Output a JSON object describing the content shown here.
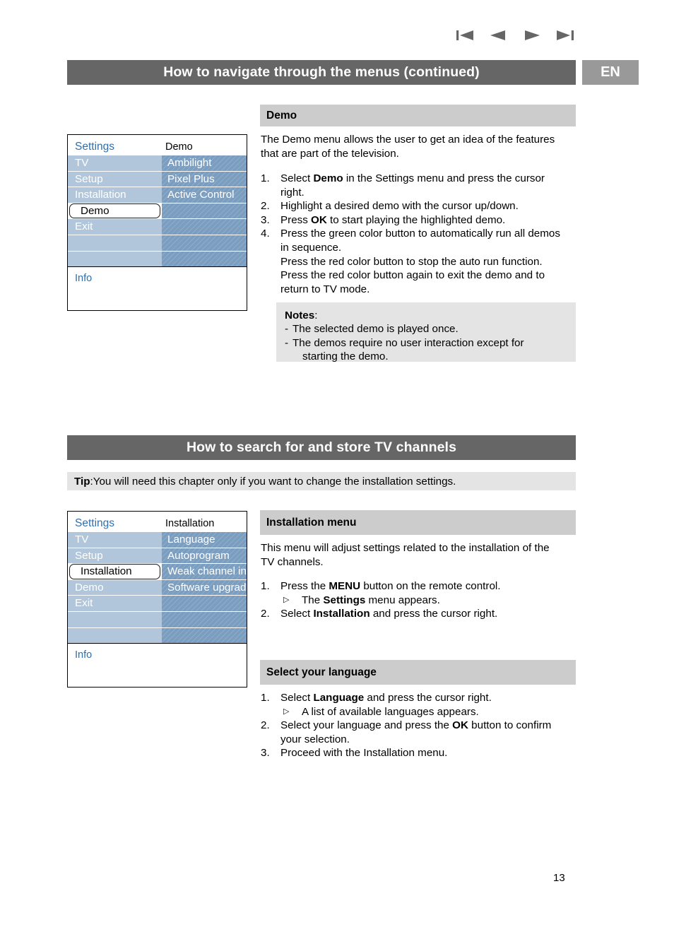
{
  "top_nav": {
    "icons": [
      {
        "name": "skip-first-icon",
        "glyph": "|◀"
      },
      {
        "name": "previous-icon",
        "glyph": "◀"
      },
      {
        "name": "next-icon",
        "glyph": "▶"
      },
      {
        "name": "skip-last-icon",
        "glyph": "▶|"
      }
    ]
  },
  "language_badge": "EN",
  "page_number": "13",
  "colors": {
    "chapter_bar": "#666666",
    "lang_badge": "#999999",
    "section_head": "#cccccc",
    "note_box": "#e4e4e4",
    "osd_left_cell": "#b1c6da",
    "osd_right_cell": "#7a9dc0",
    "osd_accent_text": "#2f6fad"
  },
  "chapters": [
    {
      "title": "How to navigate through the menus  (continued)"
    },
    {
      "title": "How to search for and store TV channels"
    }
  ],
  "tip": {
    "label": "Tip",
    "separator": ":",
    "text": "You will need this chapter only if you want to change the installation settings."
  },
  "osd_demo": {
    "title_left": "Settings",
    "title_right": "Demo",
    "info_label": "Info",
    "rows": [
      {
        "left": "TV",
        "left_selected": false,
        "right": "Ambilight"
      },
      {
        "left": "Setup",
        "left_selected": false,
        "right": "Pixel Plus"
      },
      {
        "left": "Installation",
        "left_selected": false,
        "right": "Active Control"
      },
      {
        "left": "Demo",
        "left_selected": true,
        "right": ""
      },
      {
        "left": "Exit",
        "left_selected": false,
        "right": ""
      },
      {
        "left": "",
        "left_selected": false,
        "right": ""
      },
      {
        "left": "",
        "left_selected": false,
        "right": ""
      }
    ]
  },
  "osd_installation": {
    "title_left": "Settings",
    "title_right": "Installation",
    "info_label": "Info",
    "rows": [
      {
        "left": "TV",
        "left_selected": false,
        "right": "Language"
      },
      {
        "left": "Setup",
        "left_selected": false,
        "right": "Autoprogram"
      },
      {
        "left": "Installation",
        "left_selected": true,
        "right": "Weak channel inst."
      },
      {
        "left": "Demo",
        "left_selected": false,
        "right": "Software upgrade"
      },
      {
        "left": "Exit",
        "left_selected": false,
        "right": ""
      },
      {
        "left": "",
        "left_selected": false,
        "right": ""
      },
      {
        "left": "",
        "left_selected": false,
        "right": ""
      }
    ]
  },
  "demo_section": {
    "heading": "Demo",
    "intro_line1": "The Demo menu allows the user to get an idea of the features",
    "intro_line2": "that are part of the television.",
    "steps": [
      {
        "num": "1.",
        "line1_pre": "Select ",
        "line1_bold": "Demo",
        "line1_post": " in the Settings menu and press the cursor",
        "line2": "right."
      },
      {
        "num": "2.",
        "line1_pre": "Highlight a desired demo with the cursor up/down.",
        "line1_bold": "",
        "line1_post": "",
        "line2": ""
      },
      {
        "num": "3.",
        "line1_pre": "Press ",
        "line1_bold": "OK",
        "line1_post": " to start playing the highlighted demo.",
        "line2": ""
      },
      {
        "num": "4.",
        "line1_pre": "Press the green color button to automatically run all demos",
        "line1_bold": "",
        "line1_post": "",
        "line2": "in sequence.",
        "line3": "Press the red color button to stop the auto run function.",
        "line4": "Press the red color button again to exit the demo and to",
        "line5": "return to TV mode."
      }
    ],
    "notes": {
      "title": "Notes",
      "title_suffix": ":",
      "items": [
        {
          "dash": "-",
          "text": "The selected demo is played once.",
          "cont": ""
        },
        {
          "dash": "-",
          "text": "The demos require no user interaction except for",
          "cont": "starting the demo."
        }
      ]
    }
  },
  "installation_section": {
    "heading": "Installation menu",
    "intro_line1": "This menu will adjust settings related to the installation of the",
    "intro_line2": "TV channels.",
    "steps": [
      {
        "num": "1.",
        "pre": "Press the ",
        "bold": "MENU",
        "post": " button on the remote control.",
        "sub_marker": "▷",
        "sub_pre": "The ",
        "sub_bold": "Settings",
        "sub_post": " menu appears."
      },
      {
        "num": "2.",
        "pre": "Select ",
        "bold": "Installation",
        "post": " and press the cursor right.",
        "sub_marker": "",
        "sub_pre": "",
        "sub_bold": "",
        "sub_post": ""
      }
    ]
  },
  "language_section": {
    "heading": "Select your language",
    "steps": [
      {
        "num": "1.",
        "pre": "Select ",
        "bold": "Language",
        "post": " and press the cursor right.",
        "sub_marker": "▷",
        "sub_text": "A list of available languages appears.",
        "line2": ""
      },
      {
        "num": "2.",
        "pre": "Select your language and press the ",
        "bold": "OK",
        "post": " button to confirm",
        "sub_marker": "",
        "sub_text": "",
        "line2": "your selection."
      },
      {
        "num": "3.",
        "pre": "Proceed with the Installation menu.",
        "bold": "",
        "post": "",
        "sub_marker": "",
        "sub_text": "",
        "line2": ""
      }
    ]
  }
}
